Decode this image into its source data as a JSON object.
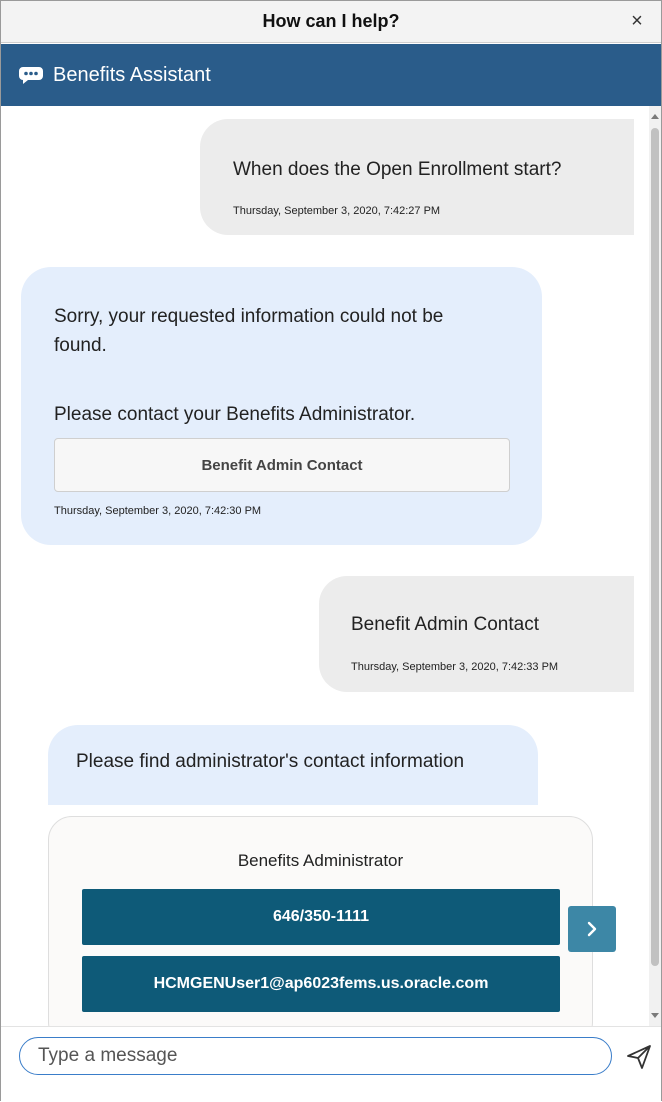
{
  "window": {
    "title": "How can I help?",
    "close_glyph": "×"
  },
  "header": {
    "icon": "chat-bubble-icon",
    "name": "Benefits Assistant",
    "color": "#2a5c8a"
  },
  "messages": [
    {
      "from": "user",
      "text": "When does the Open Enrollment start?",
      "time": "Thursday, September 3, 2020, 7:42:27 PM"
    },
    {
      "from": "bot",
      "text_line1": "Sorry, your requested information could not be",
      "text_line2": "found.",
      "text_para2": "Please contact your Benefits Administrator.",
      "action": "Benefit Admin Contact",
      "time": "Thursday, September 3, 2020, 7:42:30 PM"
    },
    {
      "from": "user",
      "text": "Benefit Admin Contact",
      "time": "Thursday, September 3, 2020, 7:42:33 PM"
    },
    {
      "from": "bot",
      "text": "Please find administrator's contact information"
    }
  ],
  "card": {
    "title": "Benefits Administrator",
    "phone": "646/350-1111",
    "email": "HCMGENUser1@ap6023fems.us.oracle.com",
    "button_color": "#0e5a78"
  },
  "carousel": {
    "next_icon": "chevron-right-icon"
  },
  "composer": {
    "placeholder": "Type a message",
    "send_icon": "send-icon"
  }
}
